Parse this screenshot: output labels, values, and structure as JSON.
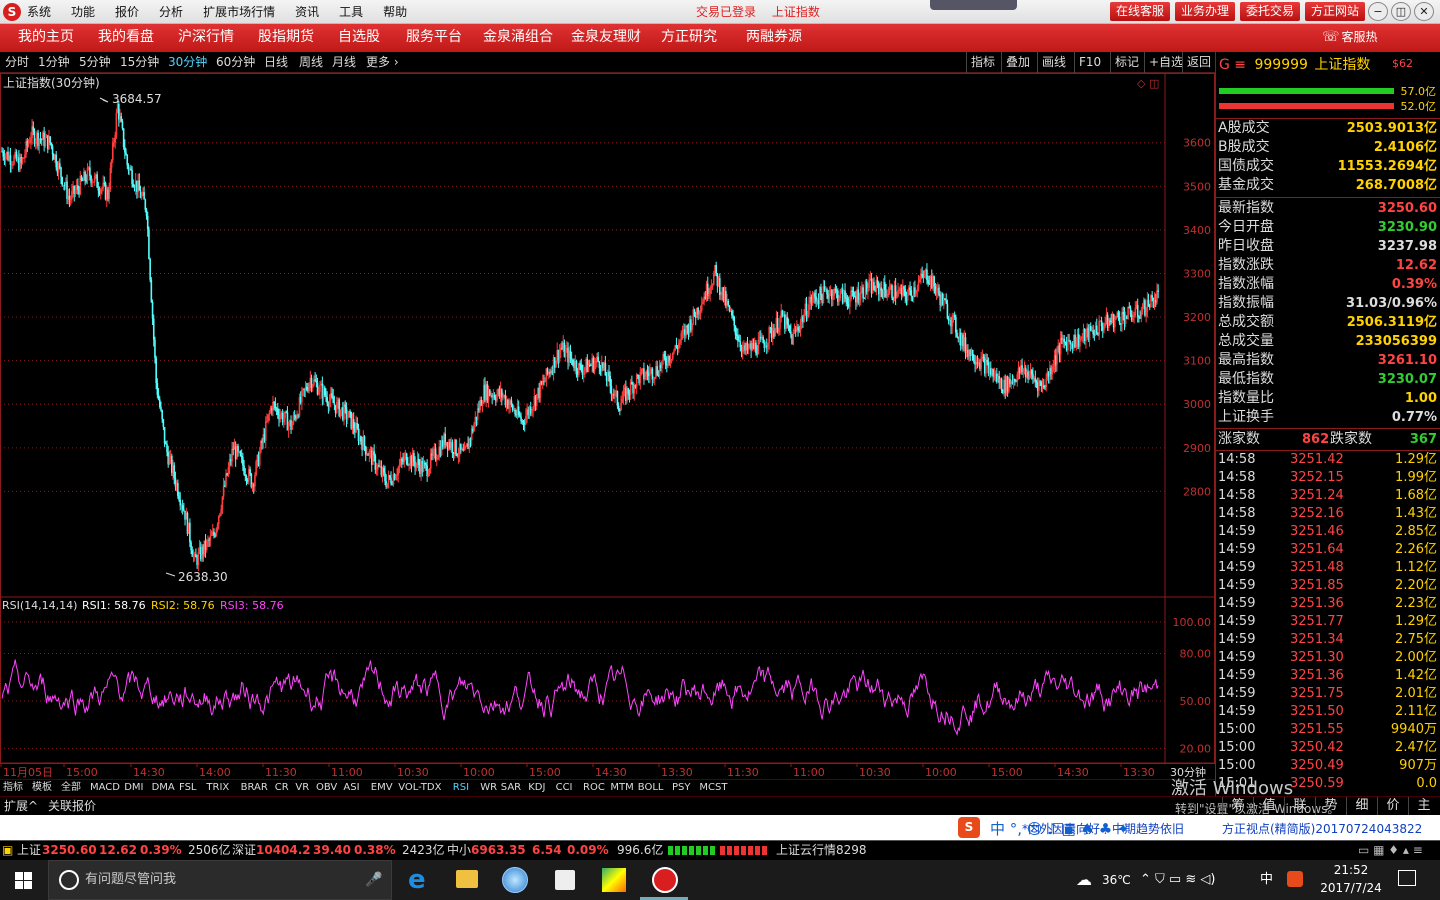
{
  "menu": {
    "logo": "S",
    "items": [
      "系统",
      "功能",
      "报价",
      "分析",
      "扩展市场行情",
      "资讯",
      "工具",
      "帮助"
    ],
    "status": [
      "交易已登录",
      "上证指数"
    ],
    "buttons": [
      "在线客服",
      "业务办理",
      "委托交易",
      "方正网站"
    ],
    "window_controls": [
      "−",
      "◫",
      "▢",
      "✕"
    ]
  },
  "nav": {
    "items": [
      "我的主页",
      "我的看盘",
      "沪深行情",
      "股指期货",
      "自选股",
      "服务平台",
      "金泉涌组合",
      "金泉友理财",
      "方正研究",
      "两融券源"
    ],
    "hotline_label": "客服热线:",
    "hotline_number": "95571"
  },
  "periods": {
    "items": [
      "分时",
      "1分钟",
      "5分钟",
      "15分钟",
      "30分钟",
      "60分钟",
      "日线",
      "周线",
      "月线",
      "更多 ›"
    ],
    "active": 4
  },
  "tools": [
    "指标",
    "叠加",
    "画线",
    "F10",
    "标记",
    "+自选",
    "返回"
  ],
  "chart": {
    "title": "上证指数(30分钟)",
    "high_label": "3684.57",
    "low_label": "2638.30"
  },
  "rsi": {
    "title": "RSI(14,14,14)",
    "rsi1_label": "RSI1: 58.76",
    "rsi2_label": "RSI2: 58.76",
    "rsi3_label": "RSI3: 58.76"
  },
  "chart_data": [
    {
      "type": "candlestick",
      "title": "上证指数(30分钟)",
      "ylim": [
        2560,
        3760
      ],
      "y_ticks": [
        3600,
        3500,
        3400,
        3300,
        3200,
        3100,
        3000,
        2900,
        2800
      ],
      "x_tick_labels": [
        "11月05日",
        "15:00",
        "14:30",
        "14:00",
        "11:30",
        "11:00",
        "10:30",
        "10:00",
        "15:00",
        "14:30",
        "13:30",
        "11:30",
        "11:00",
        "10:30",
        "10:00",
        "15:00",
        "14:30",
        "13:30"
      ],
      "x_unit": "30分钟",
      "approx_path": [
        [
          0,
          3580
        ],
        [
          4,
          3550
        ],
        [
          6,
          3620
        ],
        [
          10,
          3600
        ],
        [
          14,
          3470
        ],
        [
          18,
          3530
        ],
        [
          22,
          3480
        ],
        [
          24,
          3684.57
        ],
        [
          26,
          3550
        ],
        [
          30,
          3450
        ],
        [
          32,
          3050
        ],
        [
          34,
          2900
        ],
        [
          38,
          2750
        ],
        [
          40,
          2638.3
        ],
        [
          44,
          2700
        ],
        [
          48,
          2900
        ],
        [
          52,
          2820
        ],
        [
          56,
          3000
        ],
        [
          60,
          2950
        ],
        [
          64,
          3060
        ],
        [
          68,
          3010
        ],
        [
          72,
          2970
        ],
        [
          76,
          2890
        ],
        [
          80,
          2820
        ],
        [
          84,
          2880
        ],
        [
          88,
          2850
        ],
        [
          92,
          2920
        ],
        [
          96,
          2880
        ],
        [
          100,
          3030
        ],
        [
          104,
          3020
        ],
        [
          108,
          2960
        ],
        [
          112,
          3040
        ],
        [
          116,
          3130
        ],
        [
          120,
          3080
        ],
        [
          124,
          3100
        ],
        [
          128,
          3000
        ],
        [
          132,
          3060
        ],
        [
          136,
          3080
        ],
        [
          140,
          3130
        ],
        [
          144,
          3210
        ],
        [
          148,
          3300
        ],
        [
          150,
          3240
        ],
        [
          154,
          3120
        ],
        [
          158,
          3140
        ],
        [
          162,
          3200
        ],
        [
          164,
          3150
        ],
        [
          168,
          3240
        ],
        [
          172,
          3260
        ],
        [
          176,
          3240
        ],
        [
          180,
          3270
        ],
        [
          184,
          3260
        ],
        [
          188,
          3250
        ],
        [
          192,
          3300
        ],
        [
          196,
          3220
        ],
        [
          200,
          3130
        ],
        [
          204,
          3090
        ],
        [
          208,
          3040
        ],
        [
          212,
          3080
        ],
        [
          216,
          3040
        ],
        [
          220,
          3140
        ],
        [
          224,
          3150
        ],
        [
          228,
          3180
        ],
        [
          232,
          3200
        ],
        [
          236,
          3210
        ],
        [
          240,
          3250.6
        ]
      ]
    },
    {
      "type": "line",
      "title": "RSI(14,14,14)",
      "ylim": [
        12,
        112
      ],
      "y_ticks": [
        100,
        80,
        50,
        20
      ],
      "last_value": 58.76
    }
  ],
  "side": {
    "code_prefix": "G ≡",
    "code": "999999",
    "name": "上证指数",
    "badge": "$62",
    "bar_pcts": [
      "57.0亿",
      "52.0亿"
    ],
    "volumes": [
      {
        "label": "A股成交",
        "value": "2503.9013亿"
      },
      {
        "label": "B股成交",
        "value": "2.4106亿"
      },
      {
        "label": "国债成交",
        "value": "11553.2694亿"
      },
      {
        "label": "基金成交",
        "value": "268.7008亿"
      }
    ],
    "quotes": [
      {
        "label": "最新指数",
        "value": "3250.60",
        "c": "up"
      },
      {
        "label": "今日开盘",
        "value": "3230.90",
        "c": "dn"
      },
      {
        "label": "昨日收盘",
        "value": "3237.98",
        "c": "wh"
      },
      {
        "label": "指数涨跌",
        "value": "12.62",
        "c": "up"
      },
      {
        "label": "指数涨幅",
        "value": "0.39%",
        "c": "up"
      },
      {
        "label": "指数振幅",
        "value": "31.03/0.96%",
        "c": "wh"
      },
      {
        "label": "总成交额",
        "value": "2506.3119亿",
        "c": "yl"
      },
      {
        "label": "总成交量",
        "value": "233056399",
        "c": "yl"
      },
      {
        "label": "最高指数",
        "value": "3261.10",
        "c": "up"
      },
      {
        "label": "最低指数",
        "value": "3230.07",
        "c": "dn"
      },
      {
        "label": "指数量比",
        "value": "1.00",
        "c": "yl"
      },
      {
        "label": "上证换手",
        "value": "0.77%",
        "c": "wh"
      }
    ],
    "updown": {
      "up_label": "涨家数",
      "up": "862",
      "down_label": "跌家数",
      "down": "367"
    },
    "ticks": [
      [
        "14:58",
        "3251.42",
        "1.29亿"
      ],
      [
        "14:58",
        "3252.15",
        "1.99亿"
      ],
      [
        "14:58",
        "3251.24",
        "1.68亿"
      ],
      [
        "14:58",
        "3252.16",
        "1.43亿"
      ],
      [
        "14:59",
        "3251.46",
        "2.85亿"
      ],
      [
        "14:59",
        "3251.64",
        "2.26亿"
      ],
      [
        "14:59",
        "3251.48",
        "1.12亿"
      ],
      [
        "14:59",
        "3251.85",
        "2.20亿"
      ],
      [
        "14:59",
        "3251.36",
        "2.23亿"
      ],
      [
        "14:59",
        "3251.77",
        "1.29亿"
      ],
      [
        "14:59",
        "3251.34",
        "2.75亿"
      ],
      [
        "14:59",
        "3251.30",
        "2.00亿"
      ],
      [
        "14:59",
        "3251.36",
        "1.42亿"
      ],
      [
        "14:59",
        "3251.75",
        "2.01亿"
      ],
      [
        "14:59",
        "3251.50",
        "2.11亿"
      ],
      [
        "15:00",
        "3251.55",
        "9940万"
      ],
      [
        "15:00",
        "3250.42",
        "2.47亿"
      ],
      [
        "15:00",
        "3250.49",
        "907万"
      ],
      [
        "15:01",
        "3250.59",
        "0.0"
      ]
    ]
  },
  "indicators": {
    "items": [
      "指标",
      "模板",
      "全部",
      "MACD",
      "DMI",
      "DMA",
      "FSL",
      "TRIX",
      "BRAR",
      "CR",
      "VR",
      "OBV",
      "ASI",
      "EMV",
      "VOL-TDX",
      "RSI",
      "WR",
      "SAR",
      "KDJ",
      "CCI",
      "ROC",
      "MTM",
      "BOLL",
      "PSY",
      "MCST"
    ],
    "active": "RSI"
  },
  "side_tabs": [
    "筹",
    "值",
    "联",
    "势",
    "细",
    "价",
    "主"
  ],
  "watermark": [
    "激活 Windows",
    "转到\"设置\"以激活 Windows。"
  ],
  "bar2": {
    "left": [
      "扩展^",
      "关联报价"
    ],
    "links": [
      "*内外因素向好",
      "中期趋势依旧"
    ],
    "news": "方正视点(精简版)20170724043822"
  },
  "ticker": {
    "sh_label": "上证",
    "sh_val": "3250.60",
    "sh_chg": "12.62",
    "sh_pct": "0.39%",
    "sh_amt": "2506亿",
    "sz_label": "深证",
    "sz_val": "10404.2",
    "sz_chg": "39.40",
    "sz_pct": "0.38%",
    "sz_amt": "2423亿",
    "zx_label": "中小",
    "zx_val": "6963.35",
    "zx_chg": "6.54",
    "zx_pct": "0.09%",
    "zx_amt": "996.6亿",
    "cloud": "上证云行情8298"
  },
  "taskbar": {
    "search": "有问题尽管问我",
    "weather": "36℃",
    "ime": "中",
    "time": "21:52",
    "date": "2017/7/24"
  }
}
